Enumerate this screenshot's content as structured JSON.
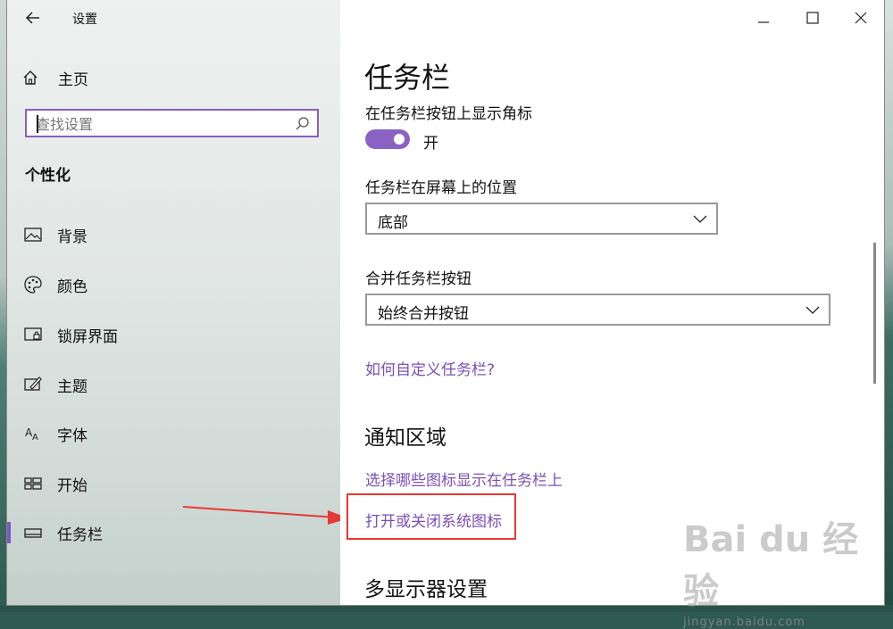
{
  "window": {
    "title": "设置"
  },
  "sidebar": {
    "home_label": "主页",
    "search_placeholder": "查找设置",
    "section_title": "个性化",
    "items": [
      {
        "label": "背景",
        "icon": "image-icon"
      },
      {
        "label": "颜色",
        "icon": "palette-icon"
      },
      {
        "label": "锁屏界面",
        "icon": "lock-screen-icon"
      },
      {
        "label": "主题",
        "icon": "theme-icon"
      },
      {
        "label": "字体",
        "icon": "font-icon"
      },
      {
        "label": "开始",
        "icon": "start-icon"
      },
      {
        "label": "任务栏",
        "icon": "taskbar-icon",
        "active": true
      }
    ]
  },
  "content": {
    "page_title": "任务栏",
    "badge_label": "在任务栏按钮上显示角标",
    "badge_toggle_state": "开",
    "position_label": "任务栏在屏幕上的位置",
    "position_value": "底部",
    "combine_label": "合并任务栏按钮",
    "combine_value": "始终合并按钮",
    "customize_link": "如何自定义任务栏?",
    "notification_heading": "通知区域",
    "select_icons_link": "选择哪些图标显示在任务栏上",
    "system_icons_link": "打开或关闭系统图标",
    "multi_display_heading": "多显示器设置"
  },
  "watermark": {
    "logo": "Bai du 经验",
    "url": "jingyan.baidu.com"
  },
  "colors": {
    "accent": "#7a4fb7",
    "toggle": "#8a62c4",
    "highlight": "#e53935"
  }
}
